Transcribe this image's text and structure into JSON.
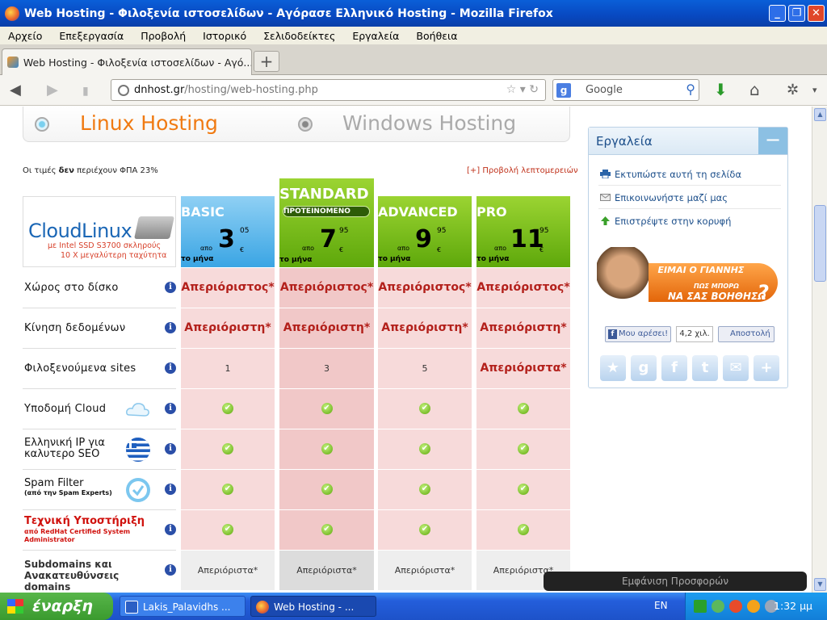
{
  "window": {
    "title": "Web Hosting - Φιλοξενία ιστοσελίδων - Αγόρασε Ελληνικό Hosting - Mozilla Firefox"
  },
  "menu": [
    "Αρχείο",
    "Επεξεργασία",
    "Προβολή",
    "Ιστορικό",
    "Σελιδοδείκτες",
    "Εργαλεία",
    "Βοήθεια"
  ],
  "tab": {
    "label": "Web Hosting - Φιλοξενία ιστοσελίδων - Αγό...",
    "new_tab": "+"
  },
  "url": {
    "domain": "dnhost.gr",
    "path": "/hosting/web-hosting.php"
  },
  "search": {
    "engine": "g",
    "placeholder": "Google"
  },
  "hosting_tabs": {
    "linux": "Linux Hosting",
    "windows": "Windows Hosting"
  },
  "vat_note": {
    "pre": "Οι τιμές ",
    "bold": "δεν",
    "post": " περιέχουν ΦΠΑ 23%"
  },
  "details_link": "[+] Προβολή λεπτομερειών",
  "cloudlinux": {
    "name": "CloudLinux",
    "line1": "με Intel SSD S3700 σκληρούς",
    "line2": "10 X μεγαλύτερη ταχύτητα"
  },
  "plans": [
    {
      "name": "BASIC",
      "apo": "απο",
      "int": "3",
      "dec": "05",
      "eur": "€",
      "month": "το μήνα"
    },
    {
      "name": "STANDARD",
      "badge": "ΠΡΟΤΕΙΝΟΜΕΝΟ",
      "apo": "απο",
      "int": "7",
      "dec": "95",
      "eur": "€",
      "month": "το μήνα"
    },
    {
      "name": "ADVANCED",
      "apo": "απο",
      "int": "9",
      "dec": "95",
      "eur": "€",
      "month": "το μήνα"
    },
    {
      "name": "PRO",
      "apo": "απο",
      "int": "11",
      "dec": "95",
      "eur": "€",
      "month": "το μήνα"
    }
  ],
  "rows": [
    {
      "label": "Χώρος στο δίσκο",
      "values": [
        "Απεριόριστος*",
        "Απεριόριστος*",
        "Απεριόριστος*",
        "Απεριόριστος*"
      ]
    },
    {
      "label": "Κίνηση δεδομένων",
      "values": [
        "Απεριόριστη*",
        "Απεριόριστη*",
        "Απεριόριστη*",
        "Απεριόριστη*"
      ]
    },
    {
      "label": "Φιλοξενούμενα sites",
      "values": [
        "1",
        "3",
        "5",
        "Απεριόριστα*"
      ]
    },
    {
      "label": "Υποδομή Cloud",
      "values": [
        "✔",
        "✔",
        "✔",
        "✔"
      ]
    },
    {
      "label": "Ελληνική IP για καλυτερο SEO",
      "values": [
        "✔",
        "✔",
        "✔",
        "✔"
      ]
    },
    {
      "label": "Spam Filter",
      "sub": "(από την Spam Experts)",
      "values": [
        "✔",
        "✔",
        "✔",
        "✔"
      ]
    },
    {
      "label": "Τεχνική Υποστήριξη",
      "sub": "από RedHat Certified System Administrator",
      "values": [
        "✔",
        "✔",
        "✔",
        "✔"
      ]
    },
    {
      "label": "Subdomains και Ανακατευθύνσεις domains",
      "values": [
        "Απεριόριστα*",
        "Απεριόριστα*",
        "Απεριόριστα*",
        "Απεριόριστα*"
      ]
    }
  ],
  "info_glyph": "i",
  "sidebar": {
    "title": "Εργαλεία",
    "minimize": "−",
    "links": [
      "Εκτυπώστε αυτή τη σελίδα",
      "Επικοινωνήστε μαζί μας",
      "Επιστρέψτε στην κορυφή"
    ],
    "promo": {
      "l1": "ΕΙΜΑΙ Ο ΓΙΑΝΝΗΣ",
      "l2": "ΠΩΣ ΜΠΟΡΩ",
      "l3": "ΝΑ ΣΑΣ ΒΟΗΘΗΣΩ",
      "q": "?"
    },
    "fb_like": "Μου αρέσει!",
    "fb_count": "4,2 χιλ.",
    "fb_send": "Αποστολή"
  },
  "offers_bar": "Εμφάνιση Προσφορών",
  "taskbar": {
    "start": "έναρξη",
    "items": [
      "Lakis_Palavidhs ...",
      "Web Hosting - ..."
    ],
    "lang": "EN",
    "clock": "1:32 μμ"
  },
  "colors": {
    "accent_orange": "#f07a12",
    "plan_blue": "#3aa5e4",
    "plan_green": "#5ea80b",
    "cell_pink": "#f7dada",
    "red_text": "#b3201b"
  }
}
